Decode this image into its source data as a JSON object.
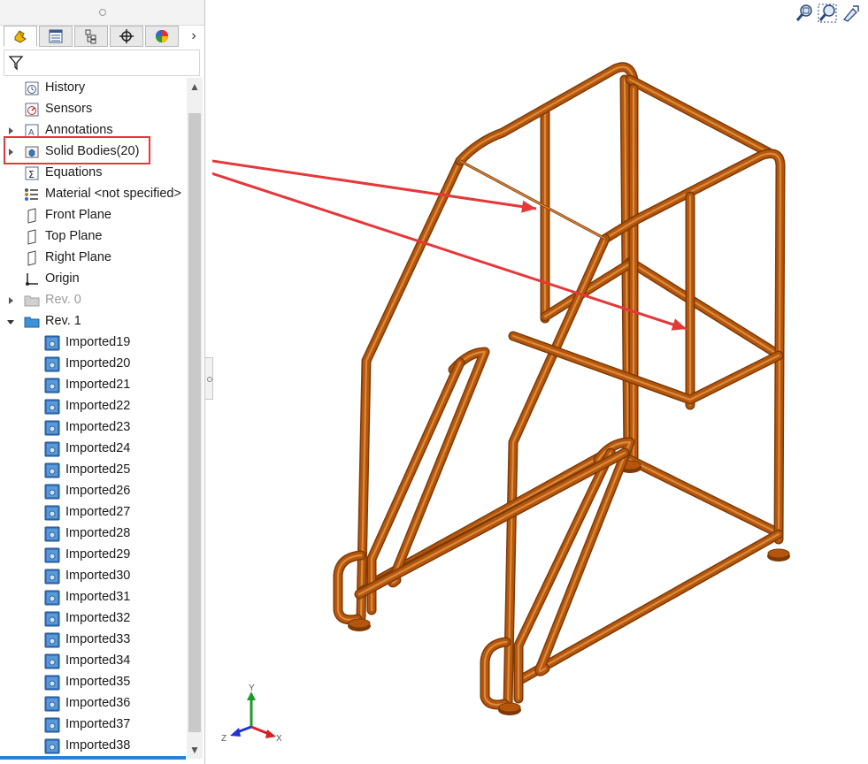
{
  "tabs": [
    {
      "name": "featuremanager",
      "icon": "featuremanager-icon"
    },
    {
      "name": "propertymanager",
      "icon": "propertymanager-icon"
    },
    {
      "name": "configurationmanager",
      "icon": "configurationmanager-icon"
    },
    {
      "name": "dimxpertmanager",
      "icon": "dimxpert-icon"
    },
    {
      "name": "displaymanager",
      "icon": "displaymanager-icon"
    }
  ],
  "tree": {
    "items": [
      {
        "label": "History",
        "icon": "history-icon",
        "indent": 0,
        "expander": "",
        "dim": false
      },
      {
        "label": "Sensors",
        "icon": "sensors-icon",
        "indent": 0,
        "expander": "",
        "dim": false
      },
      {
        "label": "Annotations",
        "icon": "annotations-icon",
        "indent": 0,
        "expander": "right",
        "dim": false
      },
      {
        "label": "Solid Bodies(20)",
        "icon": "solid-bodies-icon",
        "indent": 0,
        "expander": "right",
        "dim": false
      },
      {
        "label": "Equations",
        "icon": "equations-icon",
        "indent": 0,
        "expander": "",
        "dim": false
      },
      {
        "label": "Material <not specified>",
        "icon": "material-icon",
        "indent": 0,
        "expander": "",
        "dim": false
      },
      {
        "label": "Front Plane",
        "icon": "plane-icon",
        "indent": 0,
        "expander": "",
        "dim": false
      },
      {
        "label": "Top Plane",
        "icon": "plane-icon",
        "indent": 0,
        "expander": "",
        "dim": false
      },
      {
        "label": "Right Plane",
        "icon": "plane-icon",
        "indent": 0,
        "expander": "",
        "dim": false
      },
      {
        "label": "Origin",
        "icon": "origin-icon",
        "indent": 0,
        "expander": "",
        "dim": false
      },
      {
        "label": "Rev. 0",
        "icon": "folder-icon",
        "indent": 0,
        "expander": "right",
        "dim": true
      },
      {
        "label": "Rev. 1",
        "icon": "folder-open-icon",
        "indent": 0,
        "expander": "down",
        "dim": false
      },
      {
        "label": "Imported19",
        "icon": "imported-body-icon",
        "indent": 1,
        "expander": "",
        "dim": false
      },
      {
        "label": "Imported20",
        "icon": "imported-body-icon",
        "indent": 1,
        "expander": "",
        "dim": false
      },
      {
        "label": "Imported21",
        "icon": "imported-body-icon",
        "indent": 1,
        "expander": "",
        "dim": false
      },
      {
        "label": "Imported22",
        "icon": "imported-body-icon",
        "indent": 1,
        "expander": "",
        "dim": false
      },
      {
        "label": "Imported23",
        "icon": "imported-body-icon",
        "indent": 1,
        "expander": "",
        "dim": false
      },
      {
        "label": "Imported24",
        "icon": "imported-body-icon",
        "indent": 1,
        "expander": "",
        "dim": false
      },
      {
        "label": "Imported25",
        "icon": "imported-body-icon",
        "indent": 1,
        "expander": "",
        "dim": false
      },
      {
        "label": "Imported26",
        "icon": "imported-body-icon",
        "indent": 1,
        "expander": "",
        "dim": false
      },
      {
        "label": "Imported27",
        "icon": "imported-body-icon",
        "indent": 1,
        "expander": "",
        "dim": false
      },
      {
        "label": "Imported28",
        "icon": "imported-body-icon",
        "indent": 1,
        "expander": "",
        "dim": false
      },
      {
        "label": "Imported29",
        "icon": "imported-body-icon",
        "indent": 1,
        "expander": "",
        "dim": false
      },
      {
        "label": "Imported30",
        "icon": "imported-body-icon",
        "indent": 1,
        "expander": "",
        "dim": false
      },
      {
        "label": "Imported31",
        "icon": "imported-body-icon",
        "indent": 1,
        "expander": "",
        "dim": false
      },
      {
        "label": "Imported32",
        "icon": "imported-body-icon",
        "indent": 1,
        "expander": "",
        "dim": false
      },
      {
        "label": "Imported33",
        "icon": "imported-body-icon",
        "indent": 1,
        "expander": "",
        "dim": false
      },
      {
        "label": "Imported34",
        "icon": "imported-body-icon",
        "indent": 1,
        "expander": "",
        "dim": false
      },
      {
        "label": "Imported35",
        "icon": "imported-body-icon",
        "indent": 1,
        "expander": "",
        "dim": false
      },
      {
        "label": "Imported36",
        "icon": "imported-body-icon",
        "indent": 1,
        "expander": "",
        "dim": false
      },
      {
        "label": "Imported37",
        "icon": "imported-body-icon",
        "indent": 1,
        "expander": "",
        "dim": false
      },
      {
        "label": "Imported38",
        "icon": "imported-body-icon",
        "indent": 1,
        "expander": "",
        "dim": false
      }
    ]
  },
  "hud": [
    {
      "name": "zoom-to-fit",
      "icon": "zoom-to-fit-icon"
    },
    {
      "name": "zoom-to-area",
      "icon": "zoom-to-area-icon"
    },
    {
      "name": "previous-view",
      "icon": "previous-view-icon"
    }
  ],
  "triad": {
    "x_label": "X",
    "y_label": "Y",
    "z_label": "Z"
  },
  "colors": {
    "model": "#b5560c",
    "model_dark": "#7d3a06",
    "model_light": "#d98a3c",
    "callout": "#e5383b",
    "accent": "#2a7fd6"
  }
}
